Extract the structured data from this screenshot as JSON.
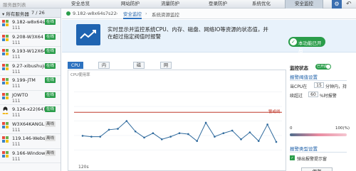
{
  "app": {
    "title": "服务器列表"
  },
  "nav": {
    "tabs": [
      {
        "label": "安全总览"
      },
      {
        "label": "网站防护"
      },
      {
        "label": "流量防护"
      },
      {
        "label": "登录防护"
      },
      {
        "label": "系统优化"
      },
      {
        "label": "安全监控"
      }
    ],
    "active_tab": "安全监控"
  },
  "sidebar": {
    "group_label": "所有服务器",
    "count": "7 / 26",
    "servers": [
      {
        "name": "9.182-w8x64s",
        "sub": "111",
        "status": "在线",
        "online": true,
        "os": "windows"
      },
      {
        "name": "9.208-W3X64",
        "sub": "111",
        "status": "在线",
        "online": true,
        "os": "windows"
      },
      {
        "name": "9.193-W12X64",
        "sub": "111",
        "status": "在线",
        "online": true,
        "os": "windows"
      },
      {
        "name": "9.27-xibushuju",
        "sub": "111",
        "status": "在线",
        "online": true,
        "os": "windows"
      },
      {
        "name": "9.199-JTM",
        "sub": "111",
        "status": "在线",
        "online": true,
        "os": "windows"
      },
      {
        "name": "JOWTO",
        "sub": "111",
        "status": "在线",
        "online": true,
        "os": "windows"
      },
      {
        "name": "9.126-x22(64)",
        "sub": "111",
        "status": "在线",
        "online": true,
        "os": "linux"
      },
      {
        "name": "W3X64KANGL",
        "sub": "111",
        "status": "离线",
        "online": false,
        "os": "windows"
      },
      {
        "name": "119.146-Webs",
        "sub": "111",
        "status": "离线",
        "online": false,
        "os": "windows"
      },
      {
        "name": "9.166-Window",
        "sub": "111",
        "status": "离线",
        "online": false,
        "os": "windows"
      }
    ]
  },
  "breadcrumb": {
    "ip": "9.182-w8x64s7s22",
    "current": "安全监控",
    "sub": "系统资源监控"
  },
  "banner": {
    "description": "实时显示并监控系统CPU、内存、磁盘、网络IO等资源的状态值，并在超过指定阀值时报警",
    "enabled_label": "本功能已开启"
  },
  "tabs": [
    {
      "label": "CPU使用率"
    },
    {
      "label": "内存使用率"
    },
    {
      "label": "磁盘"
    },
    {
      "label": "网络IO"
    }
  ],
  "chart_data": {
    "type": "line",
    "ylabel": "CPU使用率",
    "xlabel": "120s",
    "ylim": [
      0,
      100
    ],
    "threshold": 60,
    "threshold_label": "警戒线",
    "values": [
      33,
      32,
      32,
      40,
      41,
      50,
      38,
      31,
      36,
      29,
      32,
      36,
      35,
      27,
      48,
      32,
      36,
      39,
      29,
      37,
      27,
      46,
      26
    ],
    "colors": {
      "line": "#2f6a9d",
      "threshold": "#c0392b",
      "grid": "#e8edf2"
    }
  },
  "monitor": {
    "status_label": "监控状态",
    "status_value": "已开启",
    "alarm_section": "报警阀值设置",
    "cpu_label": "当CPU在",
    "minutes_value": "15",
    "minutes_suffix": "分钟内，持",
    "over_label": "续超过",
    "percent_value": "60",
    "percent_suffix": "%时报警",
    "scale_min": "0",
    "scale_max": "100(%)",
    "type_section": "报警类型设置",
    "popup_label": "弹出报警提示窗",
    "save_label": "保存"
  }
}
